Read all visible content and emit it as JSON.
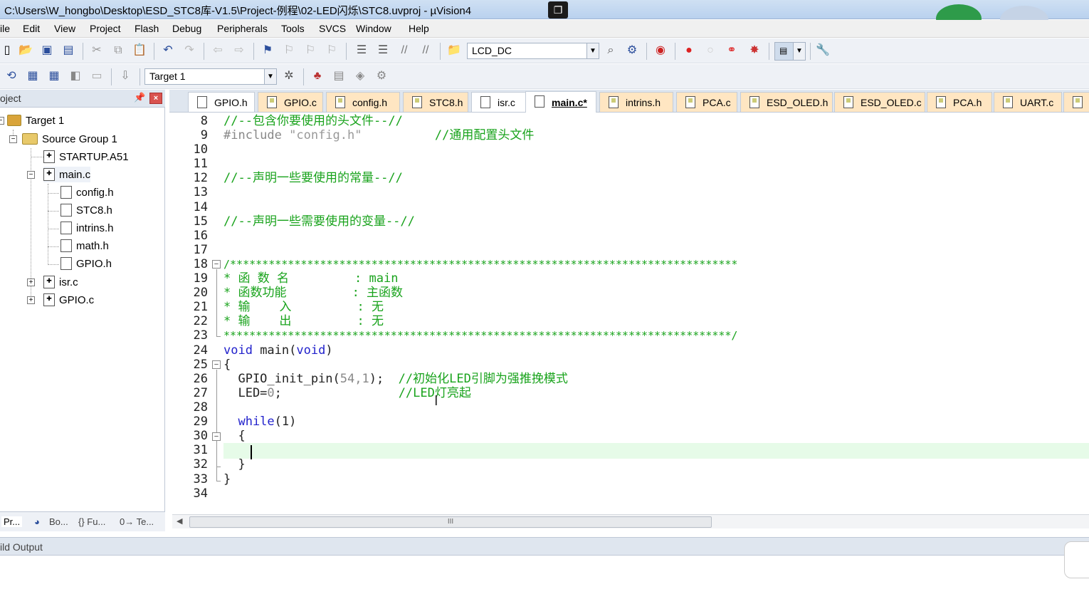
{
  "window": {
    "title": "C:\\Users\\W_hongbo\\Desktop\\ESD_STC8库-V1.5\\Project-例程\\02-LED闪烁\\STC8.uvproj - µVision4"
  },
  "menu": [
    "ile",
    "Edit",
    "View",
    "Project",
    "Flash",
    "Debug",
    "Peripherals",
    "Tools",
    "SVCS",
    "Window",
    "Help"
  ],
  "toolbar": {
    "find_combo_value": "LCD_DC",
    "target_combo_value": "Target 1"
  },
  "project_panel": {
    "title": "oject",
    "tree": {
      "target": "Target 1",
      "group": "Source Group 1",
      "startup": "STARTUP.A51",
      "main": "main.c",
      "main_children": [
        "config.h",
        "STC8.h",
        "intrins.h",
        "math.h",
        "GPIO.h"
      ],
      "isr": "isr.c",
      "gpio": "GPIO.c"
    },
    "bottom_tabs": [
      "Pr...",
      "Bo...",
      "{} Fu...",
      "0→ Te..."
    ]
  },
  "file_tabs": [
    "GPIO.h",
    "GPIO.c",
    "config.h",
    "STC8.h",
    "isr.c",
    "main.c*",
    "intrins.h",
    "PCA.c",
    "ESD_OLED.h",
    "ESD_OLED.c",
    "PCA.h",
    "UART.c"
  ],
  "editor": {
    "line_numbers": [
      "8",
      "9",
      "10",
      "11",
      "12",
      "13",
      "14",
      "15",
      "16",
      "17",
      "18",
      "19",
      "20",
      "21",
      "22",
      "23",
      "24",
      "25",
      "26",
      "27",
      "28",
      "29",
      "30",
      "31",
      "32",
      "33",
      "34"
    ],
    "code": {
      "l8": "//--包含你要使用的头文件--//",
      "l9_pp": "#include ",
      "l9_str": "\"config.h\"",
      "l9_cm": "//通用配置头文件",
      "l12": "//--声明一些要使用的常量--//",
      "l15": "//--声明一些需要使用的变量--//",
      "l18": "/*******************************************************************************",
      "l19": "* 函 数 名         : main",
      "l20": "* 函数功能         : 主函数",
      "l21": "* 输    入         : 无",
      "l22": "* 输    出         : 无",
      "l23": "*******************************************************************************/",
      "l24_kw": "void",
      "l24_tx": " main(",
      "l24_kw2": "void",
      "l24_end": ")",
      "l25": "{",
      "l26_tx": "  GPIO_init_pin(",
      "l26_num": "54,1",
      "l26_end": ");  ",
      "l26_cm": "//初始化LED引脚为强推挽模式",
      "l27_tx": "  LED=",
      "l27_num": "0",
      "l27_end": ";",
      "l27_cm": "//LED灯亮起",
      "l29_kw": "  while",
      "l29_tx": "(1)",
      "l30": "  {",
      "l32": "  }",
      "l33": "}"
    }
  },
  "hscroll_grip": "III",
  "output": {
    "title": "ild Output"
  }
}
